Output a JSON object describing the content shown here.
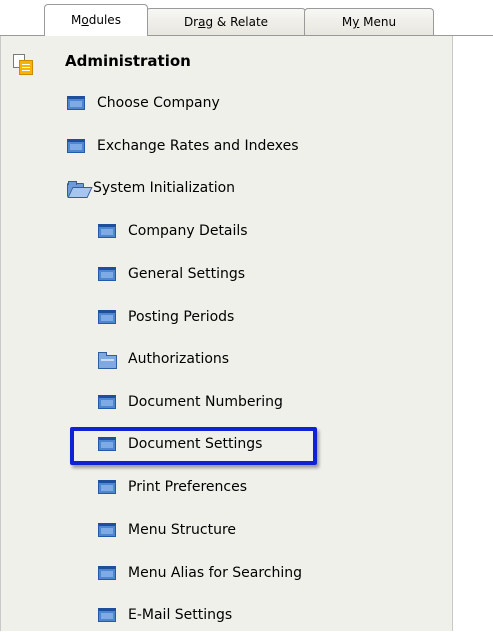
{
  "tabs": [
    {
      "pre": "M",
      "u": "o",
      "post": "dules",
      "active": true
    },
    {
      "pre": "Dr",
      "u": "a",
      "post": "g & Relate",
      "active": false
    },
    {
      "pre": "M",
      "u": "y",
      "post": " Menu",
      "active": false
    }
  ],
  "tree": {
    "header": {
      "label": "Administration",
      "icon": "administration-module-icon"
    },
    "items": [
      {
        "label": "Choose Company",
        "icon": "window-icon"
      },
      {
        "label": "Exchange Rates and Indexes",
        "icon": "window-icon"
      },
      {
        "label": "System Initialization",
        "icon": "folder-open-icon"
      },
      {
        "label": "Company Details",
        "icon": "window-icon"
      },
      {
        "label": "General Settings",
        "icon": "window-icon"
      },
      {
        "label": "Posting Periods",
        "icon": "window-icon"
      },
      {
        "label": "Authorizations",
        "icon": "folder-closed-icon"
      },
      {
        "label": "Document Numbering",
        "icon": "window-icon"
      },
      {
        "label": "Document Settings",
        "icon": "window-icon",
        "highlighted": true
      },
      {
        "label": "Print Preferences",
        "icon": "window-icon"
      },
      {
        "label": "Menu Structure",
        "icon": "window-icon"
      },
      {
        "label": "Menu Alias for Searching",
        "icon": "window-icon"
      },
      {
        "label": "E-Mail Settings",
        "icon": "window-icon"
      }
    ]
  },
  "colors": {
    "tree_background": "#f0f0ea",
    "highlight_border": "#1022d6",
    "window_icon": "#4f86d1",
    "admin_icon": "#f6b400"
  }
}
